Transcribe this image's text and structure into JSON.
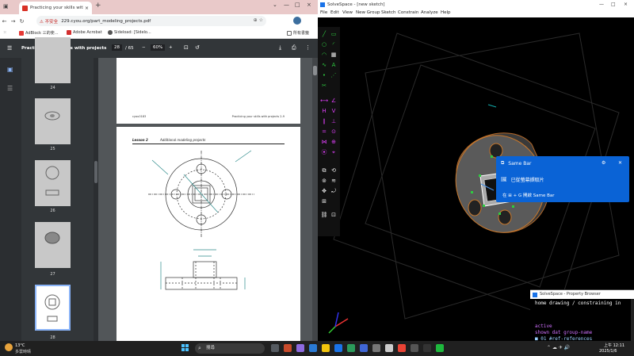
{
  "chrome": {
    "tab_title": "Practicing your skills with pro...",
    "tab_close": "×",
    "new_tab": "+",
    "window_controls": [
      "⌄",
      "—",
      "□",
      "×"
    ],
    "nav": {
      "back": "←",
      "forward": "→",
      "reload": "↻"
    },
    "address": {
      "insecure_label": "⚠ 不安全",
      "url": "229.cyou.org/part_modeling_projects.pdf"
    },
    "omnibox_icons": "⊕ ☆",
    "bookmarks": [
      {
        "label": "AdBlock 三的使…",
        "color": "#e53935"
      },
      {
        "label": "Adobe Acrobat",
        "color": "#d32f2f"
      },
      {
        "label": "Sideload: [Sidelo...",
        "color": "#555555"
      }
    ],
    "bookmarks_all": "所有書籤"
  },
  "pdf": {
    "menu_icon": "☰",
    "title": "Practicing your skills with projects",
    "page_current": "28",
    "page_total": "/ 65",
    "zoom_minus": "−",
    "zoom": "60%",
    "zoom_plus": "+",
    "icons": {
      "fit": "⊡",
      "rotate": "↺",
      "download": "⤓",
      "print": "⎙",
      "more": "⋮"
    },
    "thumbnail_labels": [
      "24",
      "25",
      "26",
      "27",
      "28"
    ],
    "page1_footer_left": "cyou0183",
    "page1_footer_right": "Practicing your skills with projects   2-9",
    "lesson_label": "Lesson 2",
    "lesson_title": "Additional modeling projects"
  },
  "solvespace": {
    "title": "SolveSpace - [new sketch]",
    "window_controls": [
      "—",
      "□",
      "×"
    ],
    "menu": [
      "File",
      "Edit",
      "View",
      "New Group",
      "Sketch",
      "Constrain",
      "Analyze",
      "Help"
    ],
    "notification": {
      "title": "Same Bar",
      "item1": "已從螢幕擷取片",
      "item2": "在 ⊞ + G 開啟 Same Bar"
    },
    "property_browser": {
      "title": "SolveSpace - Property Browser",
      "crumb": "home   drawing / constraining in",
      "lines": [
        {
          "text": "active",
          "color": "#d070ff"
        },
        {
          "text": "  shown dat group-name",
          "color": "#d070ff"
        },
        {
          "text": "  ■  01  #ref-references",
          "color": "#9ad0ff"
        }
      ]
    }
  },
  "taskbar": {
    "weather_temp": "13°C",
    "weather_desc": "多雲時晴",
    "search_placeholder": "搜尋",
    "apps": [
      "#555a60",
      "#c84a2a",
      "#8d6ae0",
      "#2a7ad4",
      "#f2c40c",
      "#1a73e8",
      "#2b9a5a",
      "#4067d6",
      "#777777",
      "#cccccc",
      "#ea4335",
      "#555555",
      "#333333",
      "#1eb83d"
    ],
    "tray_text": "⌃ ☁ ✈ 🔊",
    "time": "上午 12:11",
    "date": "2025/1/6"
  }
}
